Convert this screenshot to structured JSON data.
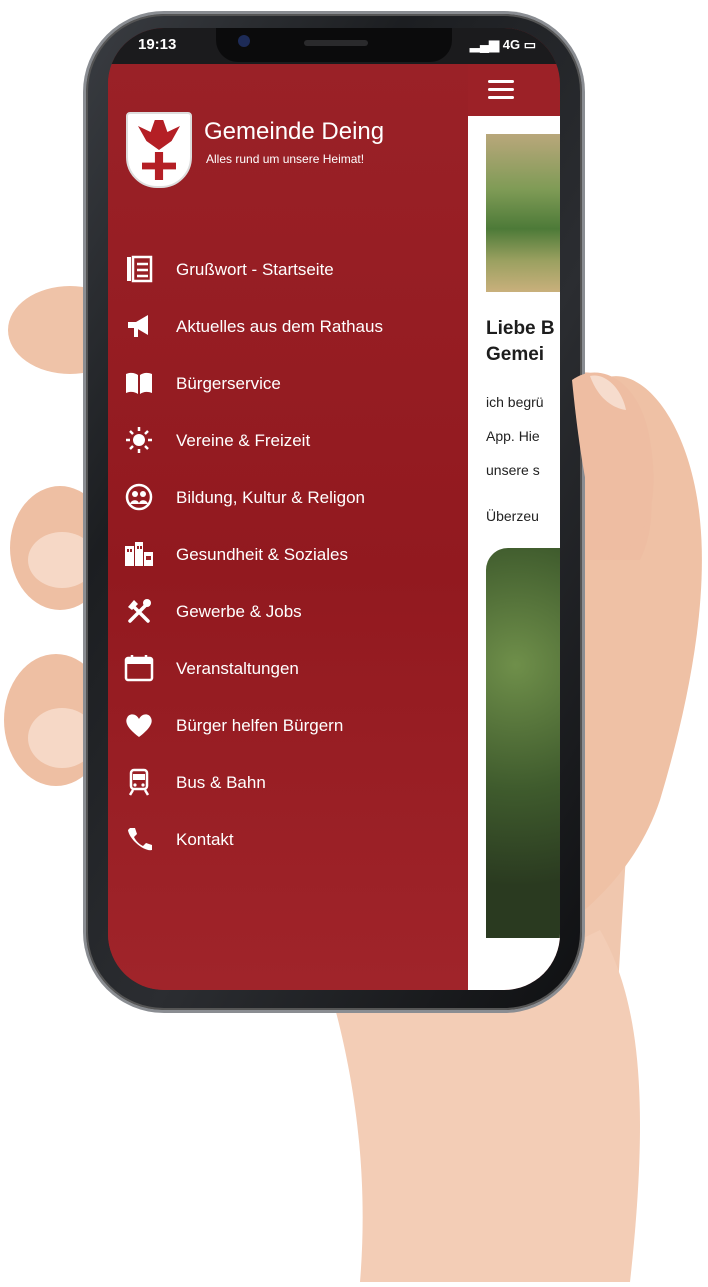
{
  "status": {
    "time": "19:13",
    "network": "4G"
  },
  "brand": {
    "title": "Gemeinde Deing",
    "subtitle": "Alles rund um unsere Heimat!"
  },
  "menu": [
    {
      "label": "Grußwort - Startseite",
      "icon": "document-icon"
    },
    {
      "label": "Aktuelles aus dem Rathaus",
      "icon": "megaphone-icon"
    },
    {
      "label": "Bürgerservice",
      "icon": "book-icon"
    },
    {
      "label": "Vereine & Freizeit",
      "icon": "sun-icon"
    },
    {
      "label": "Bildung, Kultur & Religon",
      "icon": "people-icon"
    },
    {
      "label": "Gesundheit & Soziales",
      "icon": "buildings-icon"
    },
    {
      "label": "Gewerbe & Jobs",
      "icon": "tools-icon"
    },
    {
      "label": "Veranstaltungen",
      "icon": "calendar-icon"
    },
    {
      "label": "Bürger helfen Bürgern",
      "icon": "heart-icon"
    },
    {
      "label": "Bus & Bahn",
      "icon": "train-icon"
    },
    {
      "label": "Kontakt",
      "icon": "phone-icon"
    }
  ],
  "content": {
    "heading_line1": "Liebe B",
    "heading_line2": "Gemei",
    "para1": "ich begrü",
    "para2": "App. Hie",
    "para3": "unsere s",
    "para4": "Überzeu"
  }
}
